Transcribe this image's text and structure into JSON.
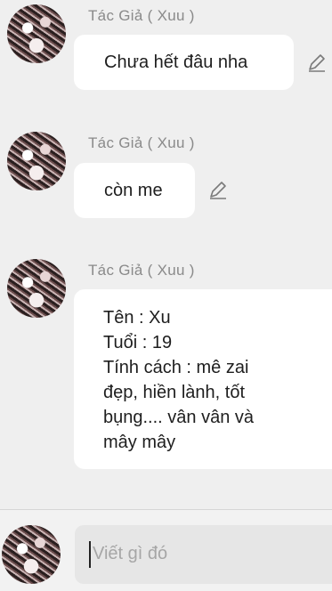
{
  "messages": [
    {
      "author": "Tác Giả ( Xuu )",
      "text": "Chưa hết đâu nha",
      "edit_icon": "pencil-icon"
    },
    {
      "author": "Tác Giả ( Xuu )",
      "text": "còn me",
      "edit_icon": "pencil-icon"
    },
    {
      "author": "Tác Giả ( Xuu )",
      "text": "Tên : Xu\nTuổi : 19\nTính cách : mê zai\nđẹp, hiền lành, tốt\nbụng.... vân vân và\nmây mây"
    }
  ],
  "composer": {
    "placeholder": "Viết gì đó"
  },
  "colors": {
    "background": "#efefef",
    "bubble": "#ffffff",
    "author_text": "#8a8a8a",
    "input": "#e6e6e6"
  }
}
